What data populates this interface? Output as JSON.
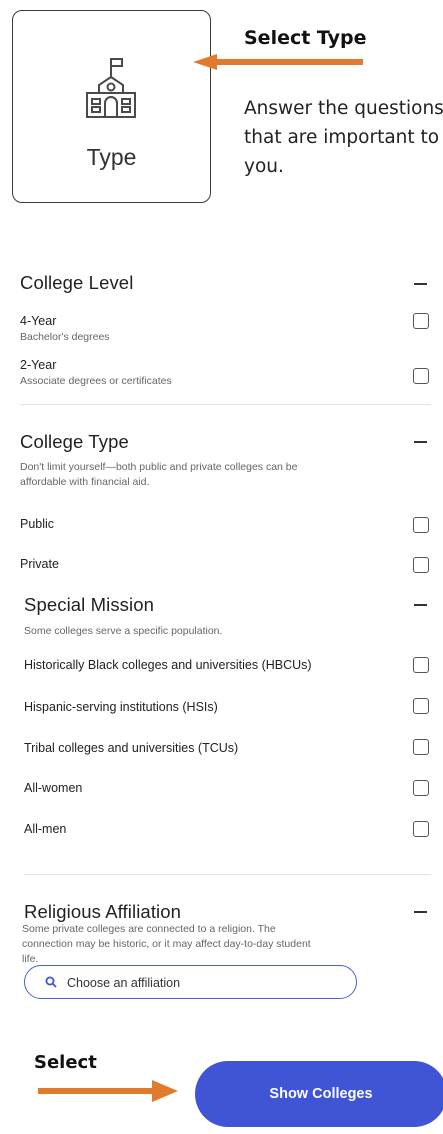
{
  "type_card": {
    "label": "Type",
    "icon": "school-building-icon"
  },
  "annotations": {
    "top_title": "Select Type",
    "top_body": "Answer the questions that are important to you.",
    "bottom_label": "Select",
    "arrow_color": "#e07b2e"
  },
  "college_level": {
    "title": "College Level",
    "options": [
      {
        "label": "4-Year",
        "sub": "Bachelor's degrees"
      },
      {
        "label": "2-Year",
        "sub": "Associate degrees or certificates"
      }
    ]
  },
  "college_type": {
    "title": "College Type",
    "description": "Don't limit yourself—both public and private colleges can be affordable with financial aid.",
    "options": [
      {
        "label": "Public"
      },
      {
        "label": "Private"
      }
    ]
  },
  "special_mission": {
    "title": "Special Mission",
    "description": "Some colleges serve a specific population.",
    "options": [
      {
        "label": "Historically Black colleges and universities (HBCUs)"
      },
      {
        "label": "Hispanic-serving institutions (HSIs)"
      },
      {
        "label": "Tribal colleges and universities (TCUs)"
      },
      {
        "label": "All-women"
      },
      {
        "label": "All-men"
      }
    ]
  },
  "religious_affiliation": {
    "title": "Religious Affiliation",
    "description": "Some private colleges are connected to a religion. The connection may be historic, or it may affect day-to-day student life.",
    "search_placeholder": "Choose an affiliation"
  },
  "show_colleges_button": "Show Colleges",
  "colors": {
    "accent": "#3f55d6",
    "border": "#4a5fcf"
  }
}
